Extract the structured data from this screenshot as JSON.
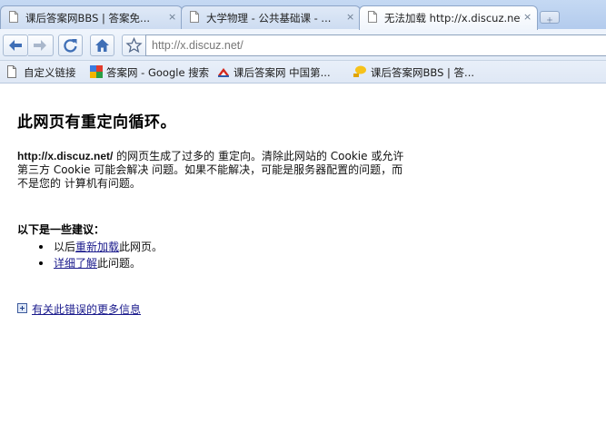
{
  "tabs": [
    {
      "title": "课后答案网BBS | 答案免...",
      "active": false
    },
    {
      "title": "大学物理 - 公共基础课 - ...",
      "active": false
    },
    {
      "title": "无法加载 http://x.discuz.net/",
      "active": true
    }
  ],
  "tab_close_glyph": "×",
  "toolbar": {
    "back_icon": "back-arrow-icon",
    "forward_icon": "forward-arrow-icon",
    "reload_icon": "reload-icon",
    "home_icon": "home-icon",
    "bookmark_star_icon": "star-icon",
    "url": "http://x.discuz.net/"
  },
  "bookmarks": [
    {
      "label": "自定义链接",
      "icon": "page-icon"
    },
    {
      "label": "答案网 - Google 搜索",
      "icon": "google-icon"
    },
    {
      "label": "课后答案网 中国第...",
      "icon": "khda-logo-icon"
    },
    {
      "label": "课后答案网BBS | 答...",
      "icon": "khda-bbs-icon"
    }
  ],
  "error": {
    "title": "此网页有重定向循环。",
    "desc_url": "http://x.discuz.net/",
    "desc_line1": " 的网页生成了过多的 重定向。清除此网站的 Cookie 或允许",
    "desc_line2": "第三方 Cookie 可能会解决 问题。如果不能解决，可能是服务器配置的问题，而",
    "desc_line3": "不是您的 计算机有问题。",
    "suggestions_title": "以下是一些建议：",
    "s1_before": "以后",
    "s1_link": "重新加载",
    "s1_after": "此网页。",
    "s2_link": "详细了解",
    "s2_after": "此问题。",
    "more_info": "有关此错误的更多信息"
  },
  "colors": {
    "link": "#1a1a8c",
    "tabstrip": "#c5d9f3",
    "active_tab": "#ffffff"
  }
}
